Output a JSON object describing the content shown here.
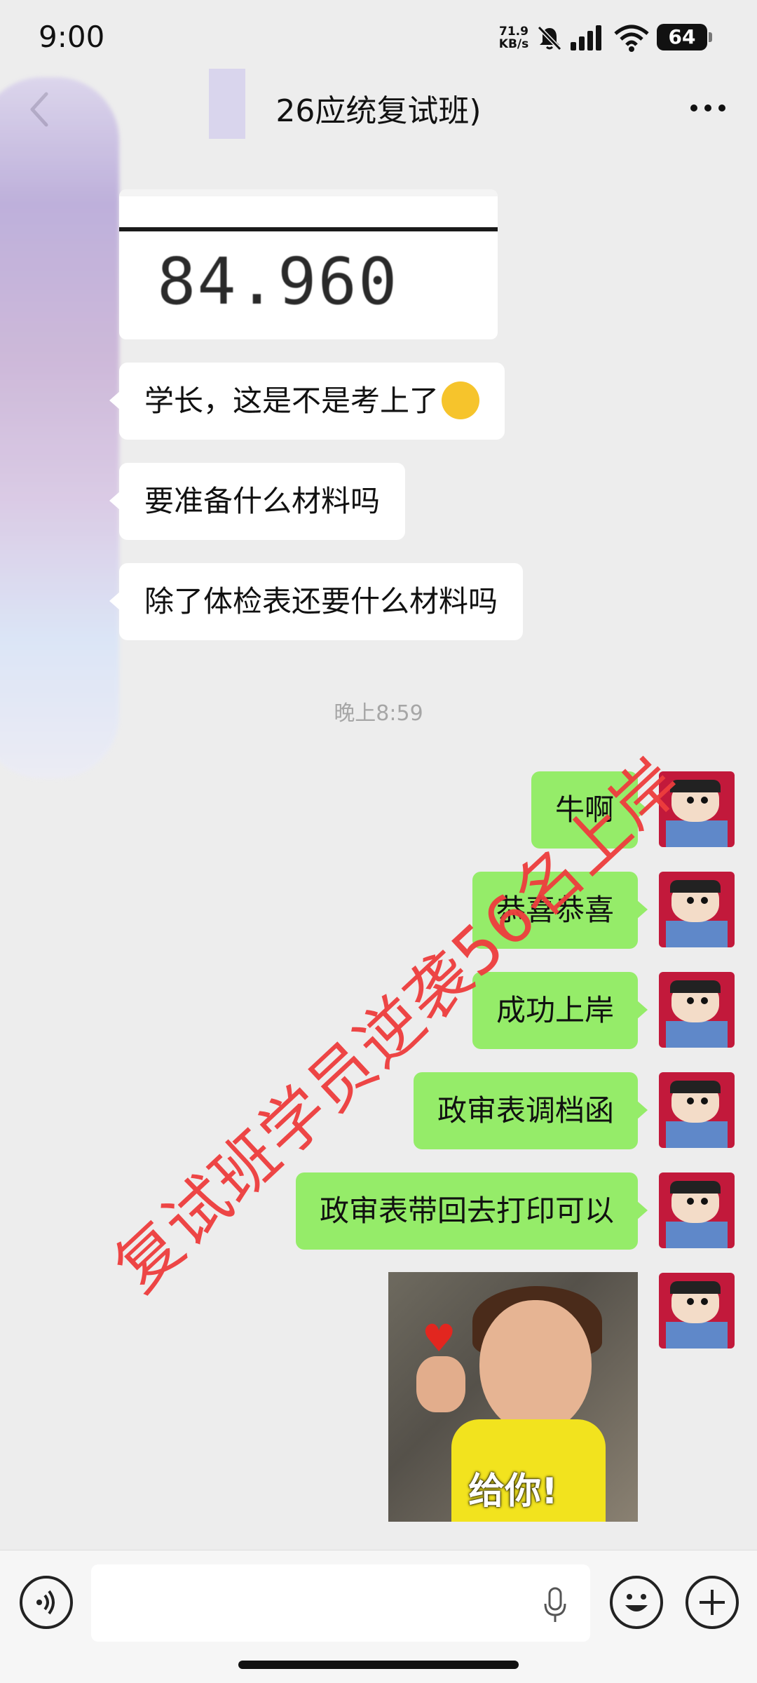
{
  "status_bar": {
    "time": "9:00",
    "net_speed_value": "71.9",
    "net_speed_unit": "KB/s",
    "battery": "64",
    "icons": [
      "mute-bell-icon",
      "signal-icon",
      "wifi-icon",
      "battery-icon"
    ]
  },
  "nav": {
    "title": "26应统复试班)",
    "back_icon": "back-chevron-icon",
    "more_icon": "more-dots-icon"
  },
  "messages": {
    "score_image_value": "84.960",
    "incoming": [
      {
        "text": "学长，这是不是考上了",
        "emoji": "crying-face"
      },
      {
        "text": "要准备什么材料吗"
      },
      {
        "text": "除了体检表还要什么材料吗"
      }
    ],
    "timestamp": "晚上8:59",
    "outgoing": [
      {
        "text": "牛啊"
      },
      {
        "text": "恭喜恭喜"
      },
      {
        "text": "成功上岸"
      },
      {
        "text": "政审表调档函"
      },
      {
        "text": "政审表带回去打印可以"
      }
    ],
    "sticker_caption": "给你!"
  },
  "watermark": "复试班学员逆袭56名上岸",
  "input_bar": {
    "text_value": "",
    "voice_icon": "voice-icon",
    "mic_icon": "mic-icon",
    "emoji_icon": "emoji-icon",
    "plus_icon": "plus-icon"
  }
}
